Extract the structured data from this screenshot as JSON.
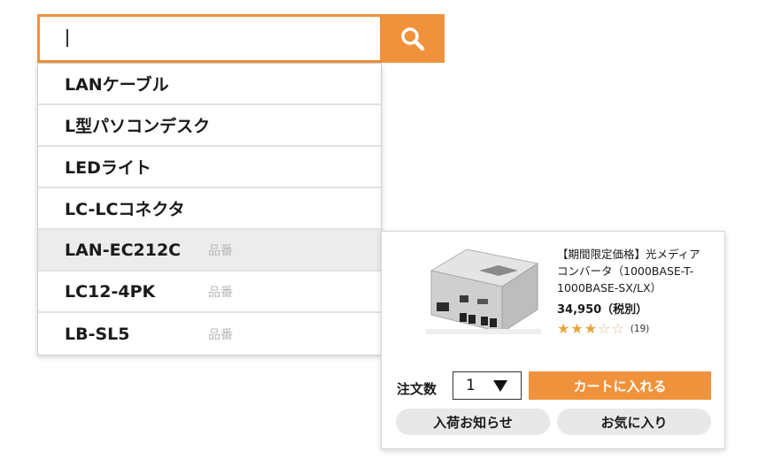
{
  "search": {
    "value": "",
    "button_icon": "search-icon",
    "accent": "#f0923c"
  },
  "suggestions": [
    {
      "text": "LANケーブル",
      "tag": "",
      "highlighted": false
    },
    {
      "text": "L型パソコンデスク",
      "tag": "",
      "highlighted": false
    },
    {
      "text": "LEDライト",
      "tag": "",
      "highlighted": false
    },
    {
      "text": "LC-LCコネクタ",
      "tag": "",
      "highlighted": false
    },
    {
      "text": "LAN-EC212C",
      "tag": "品番",
      "highlighted": true
    },
    {
      "text": "LC12-4PK",
      "tag": "品番",
      "highlighted": false
    },
    {
      "text": "LB-SL5",
      "tag": "品番",
      "highlighted": false
    }
  ],
  "product": {
    "name_line1": "【期間限定価格】光メディア",
    "name_line2": "コンバータ（1000BASE-T-",
    "name_line3": "1000BASE-SX/LX）",
    "price": "34,950（税別）",
    "rating": 3,
    "rating_max": 5,
    "review_count": "(19)",
    "qty_label": "注文数",
    "qty_value": "1",
    "cart_label": "カートに入れる",
    "notify_label": "入荷お知らせ",
    "favorite_label": "お気に入り"
  }
}
